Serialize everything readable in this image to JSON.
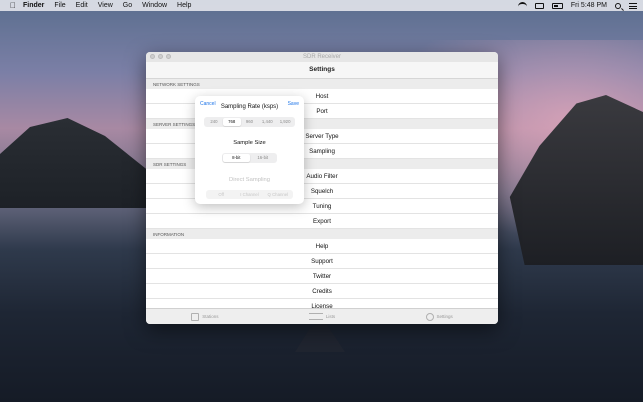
{
  "menubar": {
    "app": "Finder",
    "items": [
      "File",
      "Edit",
      "View",
      "Go",
      "Window",
      "Help"
    ],
    "clock": "Fri 5:48 PM"
  },
  "window": {
    "title": "SDR Receiver",
    "nav_title": "Settings"
  },
  "sections": [
    {
      "header": "NETWORK SETTINGS",
      "rows": [
        "Host",
        "Port"
      ]
    },
    {
      "header": "SERVER SETTINGS",
      "rows": [
        "Server Type",
        "Sampling"
      ]
    },
    {
      "header": "SDR SETTINGS",
      "rows": [
        "Audio Filter",
        "Squelch",
        "Tuning",
        "Export"
      ]
    },
    {
      "header": "INFORMATION",
      "rows": [
        "Help",
        "Support",
        "Twitter",
        "Credits",
        "License"
      ]
    }
  ],
  "tabs": [
    {
      "label": "Stations",
      "icon": "antenna-icon"
    },
    {
      "label": "Lists",
      "icon": "list-icon"
    },
    {
      "label": "Settings",
      "icon": "gear-icon"
    }
  ],
  "modal": {
    "cancel": "Cancel",
    "save": "Save",
    "title": "Sampling Rate (ksps)",
    "rates": [
      "240",
      "768",
      "960",
      "1,440",
      "1,920"
    ],
    "rate_selected": "768",
    "size_label": "Sample Size",
    "sizes": [
      "8-bit",
      "16-bit"
    ],
    "size_selected": "8-bit",
    "direct_label": "Direct Sampling",
    "direct_options": [
      "Off",
      "I Channel",
      "Q Channel"
    ]
  },
  "colors": {
    "accent": "#1b73e8"
  }
}
